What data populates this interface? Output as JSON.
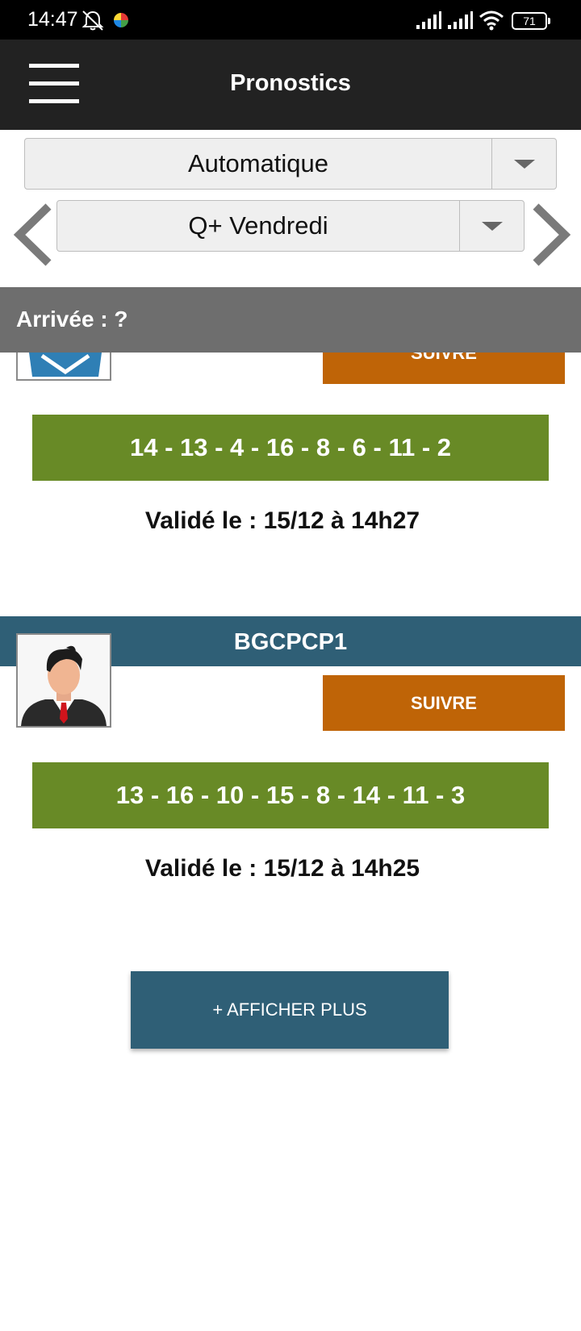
{
  "status_bar": {
    "time": "14:47",
    "battery": "71",
    "icons": [
      "bell-muted-icon",
      "app-notification-icon",
      "signal-icon",
      "signal-icon",
      "wifi-icon",
      "battery-icon"
    ]
  },
  "app_bar": {
    "title": "Pronostics",
    "menu_icon": "hamburger-menu-icon"
  },
  "filters": {
    "mode_select": {
      "value": "Automatique"
    },
    "race_select": {
      "value": "Q+ Vendredi"
    },
    "prev_icon": "chevron-left-icon",
    "next_icon": "chevron-right-icon"
  },
  "arrivee": {
    "label": "Arrivée : ?"
  },
  "cards": [
    {
      "follow_label": "SUIVRE",
      "numbers": "14 - 13 - 4 - 16 - 8 - 6 - 11 - 2",
      "validated": "Validé le : 15/12 à 14h27"
    },
    {
      "username": "BGCPCP1",
      "follow_label": "SUIVRE",
      "numbers": "13 - 16 - 10 - 15 - 8 - 14 - 11 - 3",
      "validated": "Validé le : 15/12 à 14h25"
    }
  ],
  "more_button": {
    "label": "+ AFFICHER PLUS"
  },
  "colors": {
    "status_bar": "#000000",
    "app_bar": "#222222",
    "arrivee_bar": "#6e6e6e",
    "numbers_bg": "#688a26",
    "follow_btn": "#bf6407",
    "user_header": "#2f5f76",
    "more_btn": "#2f5f76"
  }
}
